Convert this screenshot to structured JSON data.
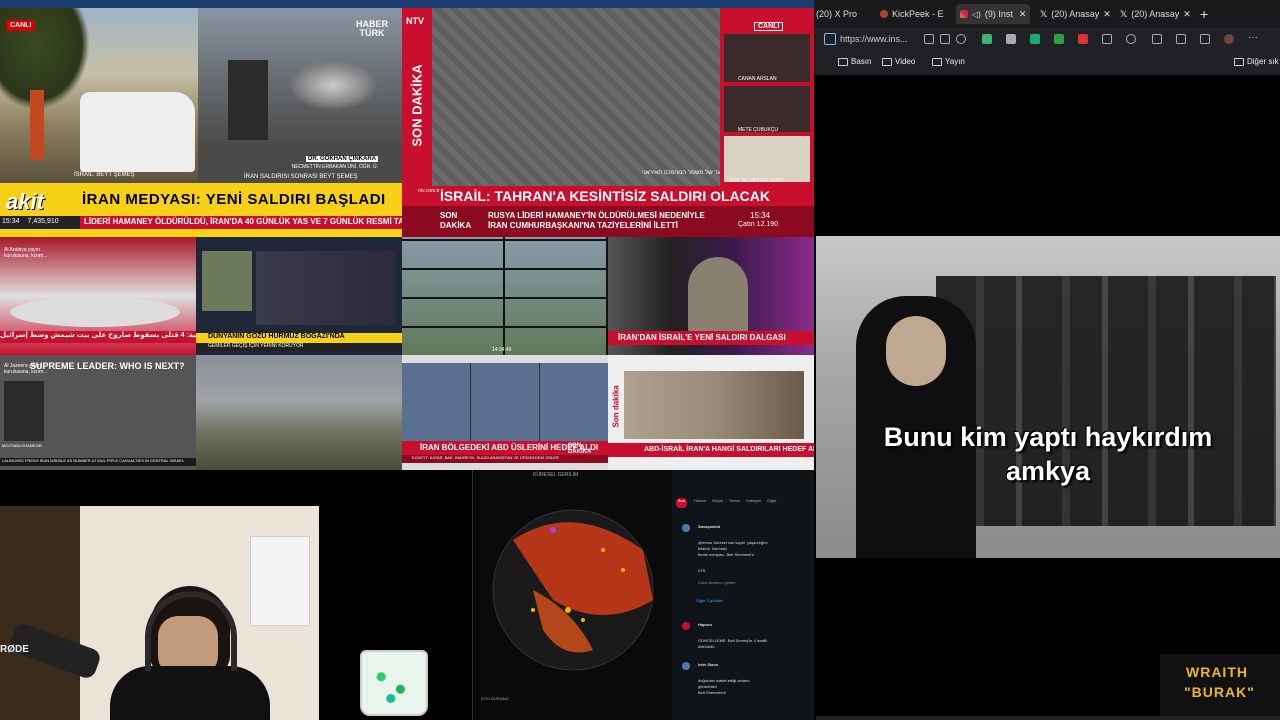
{
  "tv": {
    "p1": {
      "live": "CANLI",
      "loc1": "İSRAİL: BEYT ŞEMEŞ",
      "loc2": "CANLI"
    },
    "p2": {
      "channel": "HABER TÜRK",
      "guest_name": "DR. GÖKHAN ÇINKARA",
      "guest_title": "NECMETTİN ERBAKAN ÜNİ. ÖĞR. Ü.",
      "sub": "İRAN SALDIRISI SONRASI BEYT ŞEMEŞ"
    },
    "akit": {
      "logo": "akit",
      "headline": "İRAN MEDYASI: YENİ SALDIRI BAŞLADI",
      "ticker": "LİDERİ HAMANEY ÖLDÜRÜLDÜ, İRAN'DA 40 GÜNLÜK YAS VE 7 GÜNLÜK RESMİ TATİL İL",
      "time": "15:34",
      "count": "7,435,910"
    },
    "ntv": {
      "logo": "NTV",
      "side": "SON DAKİKA",
      "live": "CANLI",
      "hebrew": "תקיפת משגר של משמר המהפכה האיראני",
      "host1": "CANAN ARSLAN",
      "host2": "METE ÇUBUKÇU",
      "host3": "Prof. Dr. VEYSEL KURT",
      "headline": "İSRAİL: TAHRAN'A KESİNTİSİZ SALDIRI OLACAK",
      "son": "SON",
      "dakika": "DAKİKA",
      "ticker1": "RUSYA LİDERİ HAMANEY'İN ÖLDÜRÜLMESİ NEDENİYLE",
      "ticker2": "İRAN CUMHURBAŞKANI'NA TAZİYELERİNİ İLETTİ",
      "time": "15:34",
      "weather": "Çatın 12.190",
      "ntv_small": "ntv.com.tr"
    },
    "row2": {
      "alarabiya_label": "Al Arabiya yayın kurulusuna, kısım...",
      "alarabiya_ticker": "مراسلة العربية: 4 قتلى بسقوط صاروخ على بيت شيمش وسط إسرائيل",
      "dunya": "DÜNYANIN GÖZÜ HÜRMÜZ BOĞAZI'NDA",
      "dunya_sub": "GEMİLER GEÇİŞ İÇİN YERİNİ KORUYOR",
      "iran_saldiri": "İRAN'DAN İSRAİL'E YENİ SALDIRI DALGASI",
      "cam_time": "14:34:49"
    },
    "row3": {
      "aljazeera_label": "Al Jazeera yayın kurulusuna, kısım...",
      "supreme": "SUPREME LEADER: WHO IS NEXT?",
      "supreme_name": "MOJTABA KHAMENEI",
      "supreme_ticker": "LAUNCHES FRESH IRAN MISSILE AS NUMBER AT MUL PIPLE CASUALTIES IN CENTRAL ISRAEL",
      "trt_headline": "İRAN BÖLGEDEKİ ABD ÜSLERİNİ HEDEF ALDI",
      "trt_ticker": "KUVEYT: KATAR, BAE, BAHREYN, SUUDİ ARABİSTAN VE ÜRDÜN'DEKİ ÜSLER",
      "son_dakika": "SON DAKİKA",
      "abd_headline": "ABD-İSRAİL İRAN'A HANGİ SALDIRILARI HEDEF ALDI?",
      "sondakika_side": "Son dakika"
    },
    "map": {
      "header": "KÜRESEL GERİLİM",
      "footer": "ETKİ DURUMU"
    }
  },
  "browser": {
    "tabs": [
      {
        "label": "(20) X Pro"
      },
      {
        "label": "KickPeek - E"
      },
      {
        "label": "(9) Inst"
      },
      {
        "label": "(20) Anasay"
      },
      {
        "label": "(20) Anasay"
      }
    ],
    "url": "https://www.ins...",
    "bookmarks": [
      "Basın",
      "Video",
      "Yayın"
    ],
    "other_bookmarks": "Diğer sık"
  },
  "video": {
    "subtitle_line1": "Bunu kim yaptı haykırdım",
    "subtitle_line2": "amkya"
  },
  "feed": {
    "tabs": [
      "Ana",
      "Yükselt",
      "Büyük",
      "Haber",
      "Kategori",
      "Diğer"
    ],
    "post1_user": "Savaşankid",
    "post1_text1": "@emnu 'küresel can kaybı' yaşandığını",
    "post1_text2": "bildirdi. İran'daki",
    "post1_text3": "İbrani medyası, Beit Shemesh'e",
    "post1_tag": "#TS",
    "post1_more": "Daha fazlasını göster",
    "post1_footer": "Diğer 3 gönderi",
    "post2_user": "Haporu",
    "post2_text1": "GÜNCELLEME: Beit Şemeş'te 4 İsrailli",
    "post2_text2": "öldürüldü.",
    "post3_user": "Intel Slava",
    "post3_text1": "doğrudan isabet ettiği anların",
    "post3_text2": "görüntüleri",
    "post3_text3": "Beit Shemesh'e"
  },
  "webcam": {
    "mic_brand": "RØDE"
  },
  "logo": {
    "line1": "WRAITH",
    "line2": "\"BURAK\""
  },
  "colors": {
    "red": "#c8102e",
    "akit_yellow": "#f7d117",
    "browser_bg": "#202124",
    "feed_bg": "#0f1419",
    "logo_gold": "#e8b923"
  }
}
